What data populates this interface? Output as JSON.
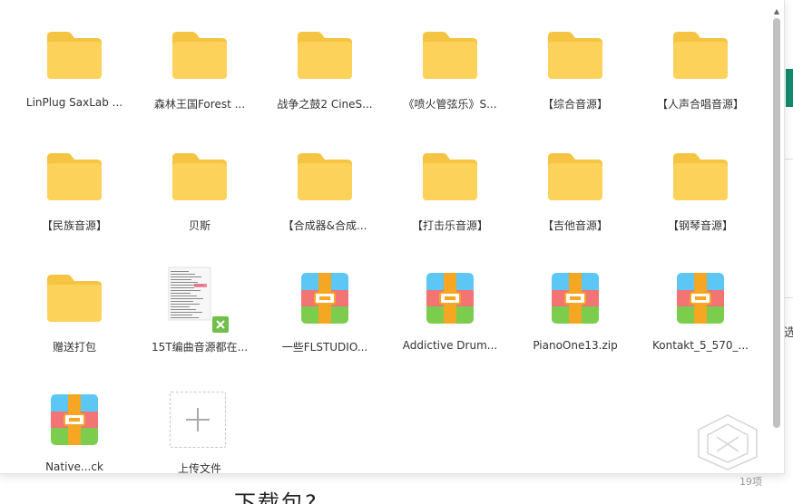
{
  "background": {
    "side_char": "选",
    "bottom_text": "下载包?"
  },
  "files": [
    {
      "name": "LinPlug SaxLab ...",
      "type": "folder"
    },
    {
      "name": "森林王国Forest ...",
      "type": "folder"
    },
    {
      "name": "战争之鼓2 CineS...",
      "type": "folder"
    },
    {
      "name": "《喷火管弦乐》S...",
      "type": "folder"
    },
    {
      "name": "【综合音源】",
      "type": "folder"
    },
    {
      "name": "【人声合唱音源】",
      "type": "folder"
    },
    {
      "name": "【民族音源】",
      "type": "folder"
    },
    {
      "name": "贝斯",
      "type": "folder"
    },
    {
      "name": "【合成器&合成...",
      "type": "folder"
    },
    {
      "name": "【打击乐音源】",
      "type": "folder"
    },
    {
      "name": "【吉他音源】",
      "type": "folder"
    },
    {
      "name": "【钢琴音源】",
      "type": "folder"
    },
    {
      "name": "赠送打包",
      "type": "folder"
    },
    {
      "name": "15T编曲音源都在...",
      "type": "spreadsheet"
    },
    {
      "name": "一些FLSTUDIO...",
      "type": "archive"
    },
    {
      "name": "Addictive Drum...",
      "type": "archive"
    },
    {
      "name": "PianoOne13.zip",
      "type": "archive"
    },
    {
      "name": "Kontakt_5_570_...",
      "type": "archive"
    },
    {
      "name": "Native...ck",
      "type": "archive"
    }
  ],
  "upload": {
    "label": "上传文件"
  },
  "status": {
    "count": "19项"
  },
  "colors": {
    "folder": "#fcd25a",
    "folder_tab": "#f6c443",
    "archive_blue": "#5cc6f4",
    "archive_red": "#f27474",
    "archive_green": "#7ccd4e",
    "archive_strap": "#f5a623",
    "accent_teal": "#138a6e"
  }
}
